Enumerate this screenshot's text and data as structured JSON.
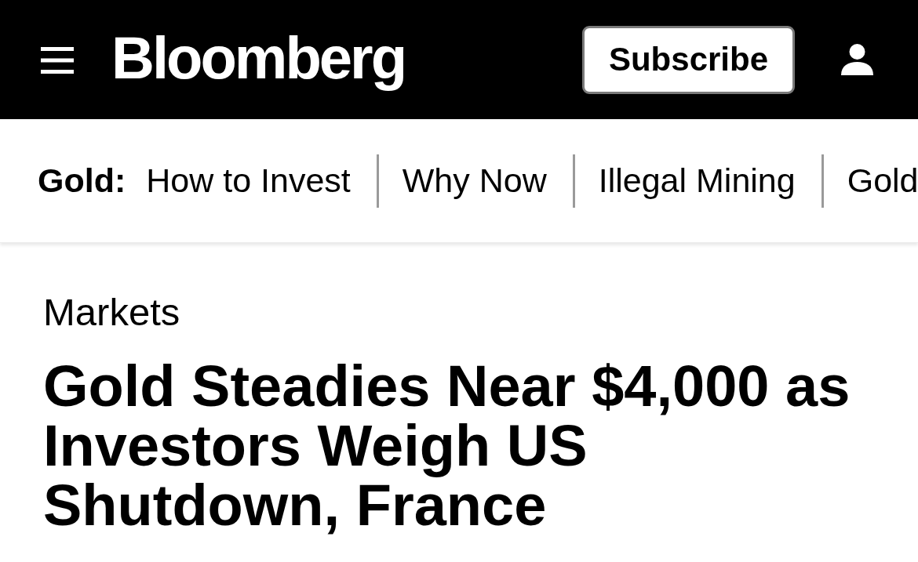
{
  "header": {
    "logo": "Bloomberg",
    "subscribe_button": "Subscribe"
  },
  "topic_nav": {
    "label": "Gold:",
    "links": [
      "How to Invest",
      "Why Now",
      "Illegal Mining",
      "Gold"
    ]
  },
  "article": {
    "section": "Markets",
    "headline": "Gold Steadies Near $4,000 as Investors Weigh US Shutdown, France"
  }
}
